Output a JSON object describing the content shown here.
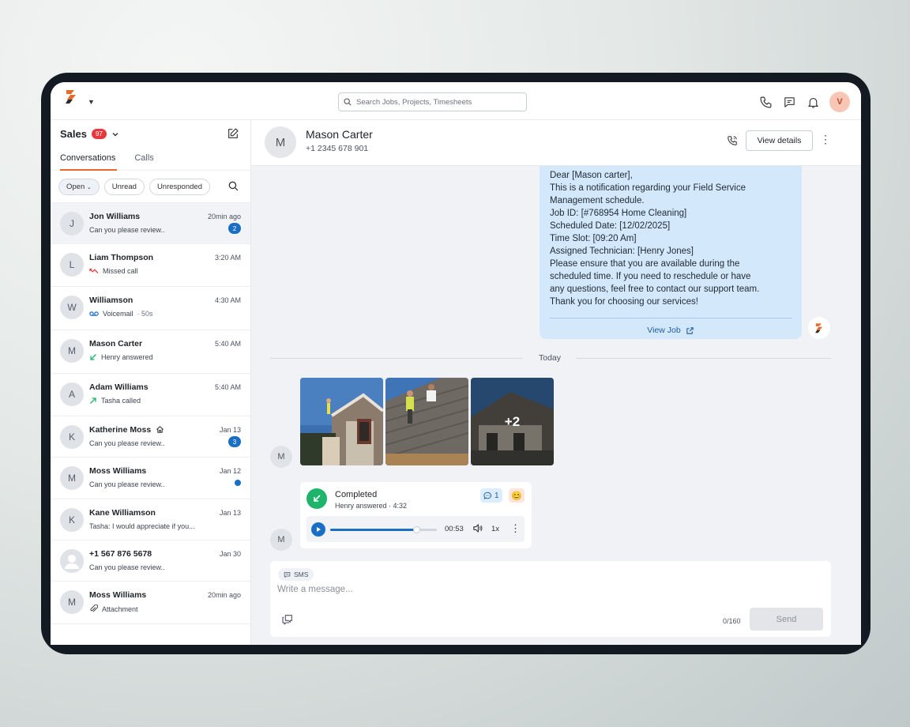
{
  "topbar": {
    "search_placeholder": "Search Jobs, Projects, Timesheets",
    "avatar_initial": "V",
    "brand_colors": {
      "orange": "#e66a2c",
      "dark": "#2b2b2b"
    }
  },
  "sidebar": {
    "title": "Sales",
    "badge": "97",
    "tabs": [
      "Conversations",
      "Calls"
    ],
    "active_tab": "Conversations",
    "filters": [
      "Open",
      "Unread",
      "Unresponded"
    ],
    "conversations": [
      {
        "initial": "J",
        "name": "Jon Williams",
        "time": "20min ago",
        "preview": "Can you please review..",
        "unread": "2",
        "kind": "text"
      },
      {
        "initial": "L",
        "name": "Liam Thompson",
        "time": "3:20 AM",
        "preview": "Missed call",
        "kind": "missed"
      },
      {
        "initial": "W",
        "name": "Williamson",
        "time": "4:30 AM",
        "preview": "Voicemail",
        "preview_extra": "· 50s",
        "kind": "voicemail"
      },
      {
        "initial": "M",
        "name": "Mason Carter",
        "time": "5:40 AM",
        "preview": "Henry answered",
        "kind": "answered"
      },
      {
        "initial": "A",
        "name": "Adam Williams",
        "time": "5:40 AM",
        "preview": "Tasha called",
        "kind": "outgoing"
      },
      {
        "initial": "K",
        "name": "Katherine Moss",
        "time": "Jan 13",
        "preview": "Can you please review..",
        "unread": "3",
        "kind": "text",
        "home": true
      },
      {
        "initial": "M",
        "name": "Moss Williams",
        "time": "Jan 12",
        "preview": "Can you please review..",
        "dot": true,
        "kind": "text"
      },
      {
        "initial": "K",
        "name": "Kane Williamson",
        "time": "Jan 13",
        "preview": "Tasha: I would appreciate if you...",
        "kind": "text"
      },
      {
        "initial": "",
        "name": "+1 567 876 5678",
        "time": "Jan 30",
        "preview": "Can you please review..",
        "kind": "text",
        "person_icon": true
      },
      {
        "initial": "M",
        "name": "Moss Williams",
        "time": "20min ago",
        "preview": "Attachment",
        "kind": "attachment"
      }
    ]
  },
  "chat": {
    "initial": "M",
    "name": "Mason Carter",
    "phone": "+1 2345 678 901",
    "view_details": "View details",
    "notification_lines": [
      "Dear [Mason carter],",
      "This is a notification regarding your Field Service",
      "Management schedule.",
      "Job ID: [#768954 Home Cleaning]",
      "Scheduled Date: [12/02/2025]",
      "Time Slot: [09:20 Am]",
      "Assigned Technician: [Henry Jones]",
      "Please ensure that you are available during the",
      "scheduled time. If you need to reschedule or have",
      "any questions, feel free to contact our support team.",
      "Thank you for choosing our services!"
    ],
    "view_job": "View Job",
    "divider": "Today",
    "photos_more": "+2",
    "sender_initial": "M",
    "call": {
      "status": "Completed",
      "answered_by": "Henry answered",
      "duration": "· 4:32",
      "comment_count": "1",
      "reaction": "😊",
      "playback_time": "00:53",
      "speed": "1x",
      "progress": 0.81
    },
    "composer": {
      "channel": "SMS",
      "placeholder": "Write a message...",
      "counter": "0/160",
      "send": "Send"
    }
  }
}
